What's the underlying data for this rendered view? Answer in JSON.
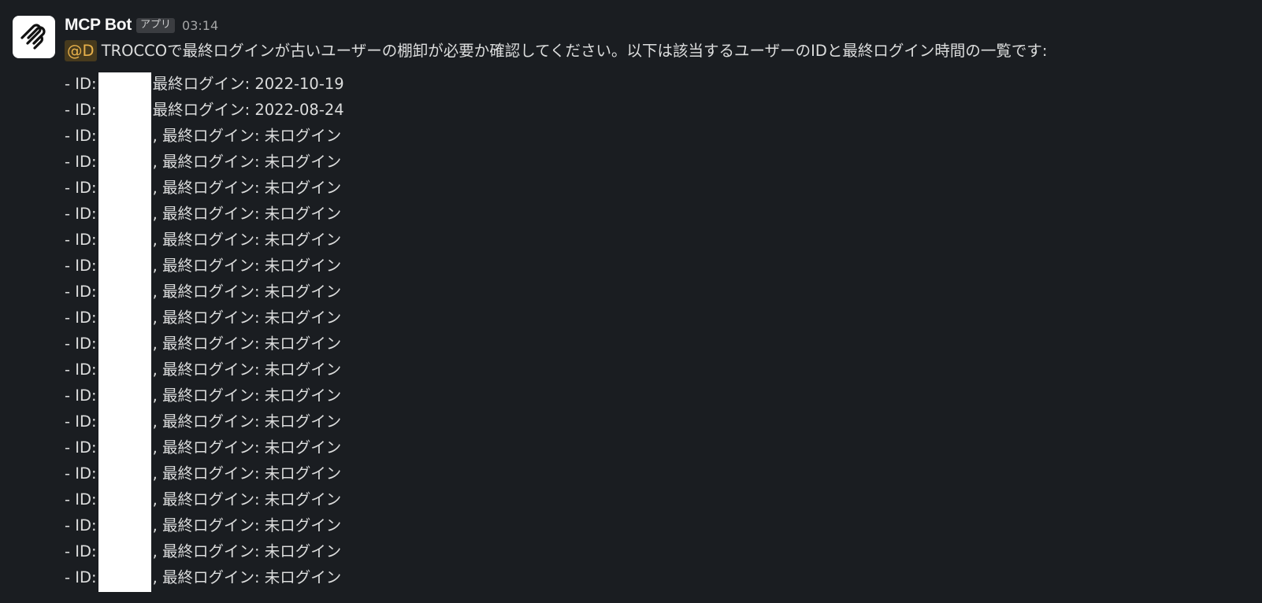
{
  "message": {
    "author": "MCP Bot",
    "badge": "アプリ",
    "time": "03:14",
    "mention": "@D",
    "text": "TROCCOで最終ログインが古いユーザーの棚卸が必要か確認してください。以下は該当するユーザーのIDと最終ログイン時間の一覧です:",
    "items": [
      {
        "prefix": "- ID:",
        "suffix": "最終ログイン: 2022-10-19"
      },
      {
        "prefix": "- ID:",
        "suffix": "最終ログイン: 2022-08-24"
      },
      {
        "prefix": "- ID:",
        "suffix": ", 最終ログイン: 未ログイン"
      },
      {
        "prefix": "- ID:",
        "suffix": ", 最終ログイン: 未ログイン"
      },
      {
        "prefix": "- ID:",
        "suffix": ", 最終ログイン: 未ログイン"
      },
      {
        "prefix": "- ID:",
        "suffix": ", 最終ログイン: 未ログイン"
      },
      {
        "prefix": "- ID:",
        "suffix": ", 最終ログイン: 未ログイン"
      },
      {
        "prefix": "- ID:",
        "suffix": ", 最終ログイン: 未ログイン"
      },
      {
        "prefix": "- ID:",
        "suffix": ", 最終ログイン: 未ログイン"
      },
      {
        "prefix": "- ID:",
        "suffix": ", 最終ログイン: 未ログイン"
      },
      {
        "prefix": "- ID:",
        "suffix": ", 最終ログイン: 未ログイン"
      },
      {
        "prefix": "- ID:",
        "suffix": ", 最終ログイン: 未ログイン"
      },
      {
        "prefix": "- ID:",
        "suffix": ", 最終ログイン: 未ログイン"
      },
      {
        "prefix": "- ID:",
        "suffix": ", 最終ログイン: 未ログイン"
      },
      {
        "prefix": "- ID:",
        "suffix": ", 最終ログイン: 未ログイン"
      },
      {
        "prefix": "- ID:",
        "suffix": ", 最終ログイン: 未ログイン"
      },
      {
        "prefix": "- ID:",
        "suffix": ", 最終ログイン: 未ログイン"
      },
      {
        "prefix": "- ID:",
        "suffix": ", 最終ログイン: 未ログイン"
      },
      {
        "prefix": "- ID:",
        "suffix": ", 最終ログイン: 未ログイン"
      },
      {
        "prefix": "- ID:",
        "suffix": ", 最終ログイン: 未ログイン"
      }
    ]
  },
  "icons": {
    "avatar": "mcp-logo-icon"
  },
  "colors": {
    "background": "#1a1d21",
    "mention_bg": "#473a1d",
    "mention_text": "#e8b14b"
  }
}
